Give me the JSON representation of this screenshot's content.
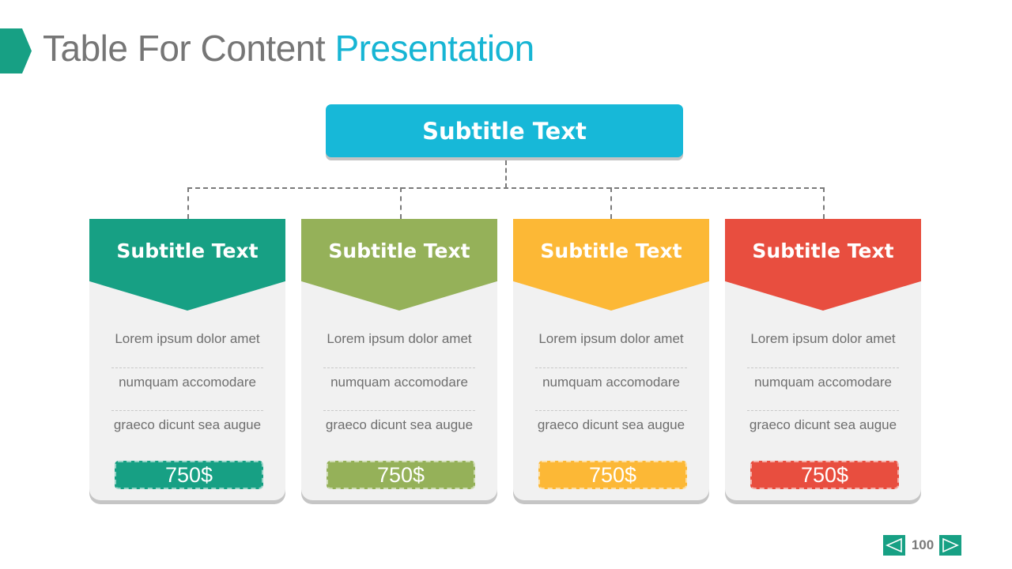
{
  "header": {
    "title_main": "Table For Content",
    "title_accent": "Presentation",
    "marker_color": "#17a084",
    "accent_color": "#17b5d4"
  },
  "top_box": {
    "label": "Subtitle Text",
    "color": "#17b8d8"
  },
  "cards": [
    {
      "title": "Subtitle Text",
      "color": "#17a084",
      "rows": [
        "Lorem ipsum dolor amet",
        "numquam accomodare",
        "graeco dicunt sea augue"
      ],
      "price": "750$"
    },
    {
      "title": "Subtitle Text",
      "color": "#95b159",
      "rows": [
        "Lorem ipsum dolor amet",
        "numquam accomodare",
        "graeco dicunt sea augue"
      ],
      "price": "750$"
    },
    {
      "title": "Subtitle Text",
      "color": "#fcb836",
      "rows": [
        "Lorem ipsum dolor amet",
        "numquam accomodare",
        "graeco dicunt sea augue"
      ],
      "price": "750$"
    },
    {
      "title": "Subtitle Text",
      "color": "#e84e3f",
      "rows": [
        "Lorem ipsum dolor amet",
        "numquam accomodare",
        "graeco dicunt sea augue"
      ],
      "price": "750$"
    }
  ],
  "pager": {
    "page_number": "100",
    "prev_icon": "triangle-left-icon",
    "next_icon": "triangle-right-icon"
  }
}
